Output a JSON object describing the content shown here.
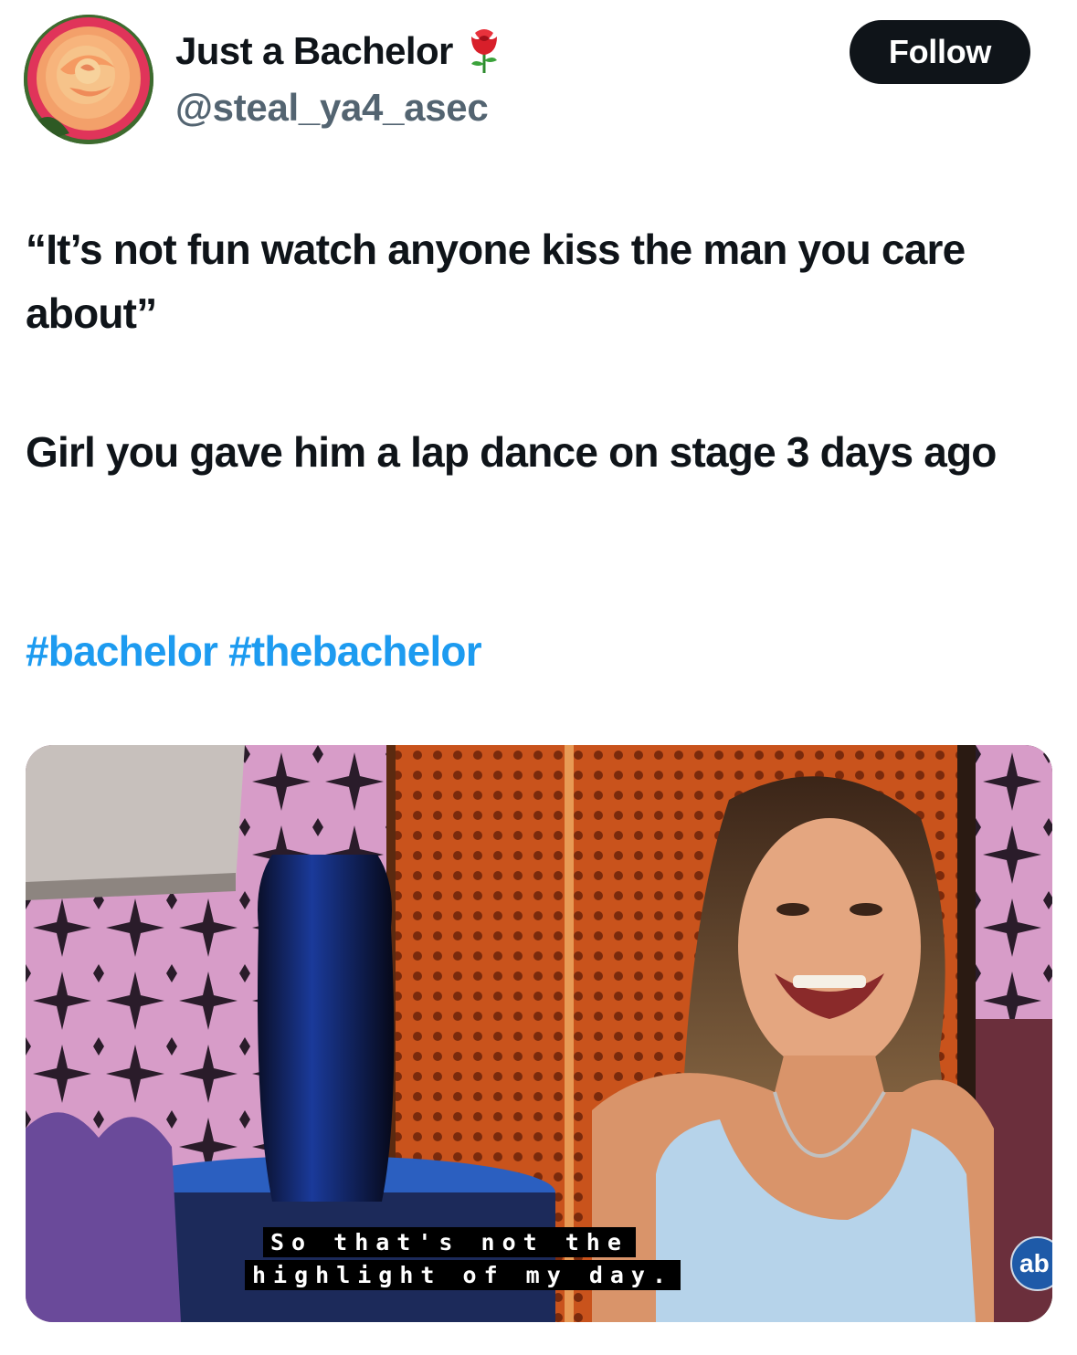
{
  "author": {
    "display_name": "Just a Bachelor",
    "handle": "@steal_ya4_asec",
    "badge_icon": "rose-icon",
    "avatar_icon": "rose-photo"
  },
  "follow_label": "Follow",
  "tweet": {
    "paragraph1": "“It’s not fun watch anyone kiss the man you care about”",
    "paragraph2": "Girl you gave him a lap dance on stage 3 days ago",
    "hashtags": [
      "#bachelor",
      "#thebachelor"
    ]
  },
  "media": {
    "caption_line1": "So that's not the",
    "caption_line2": "highlight of my day.",
    "network_logo": "ab"
  },
  "colors": {
    "text": "#0f1419",
    "secondary": "#536471",
    "link": "#1d9bf0",
    "button": "#0f1419"
  }
}
